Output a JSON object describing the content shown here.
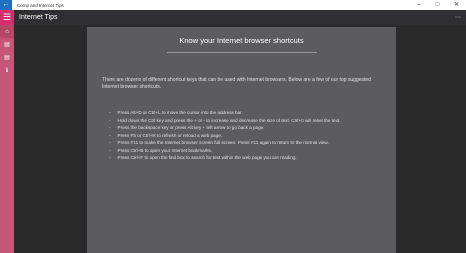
{
  "window": {
    "title": "Comp and Internet Tips",
    "back_icon": "←",
    "minimize_icon": "–",
    "maximize_icon": "□",
    "close_icon": "✕"
  },
  "appbar": {
    "title": "Internet Tips",
    "menu_icon": "☰",
    "more_icon": "⋯"
  },
  "sidebar": {
    "items": [
      {
        "icon": "⌂",
        "name": "home"
      },
      {
        "icon": "▤",
        "name": "list"
      },
      {
        "icon": "▤",
        "name": "list-alt"
      },
      {
        "icon": "ℹ",
        "name": "info"
      }
    ]
  },
  "content": {
    "heading": "Know your Internet browser shortcuts",
    "intro": "There are dozens of different shortcut keys that can be used with Internet browsers. Below are a few of our top suggested Internet browser shortcuts.",
    "tips": [
      "Press Alt+D or Ctrl+L to move the cursor into the address bar.",
      "Hold down the Ctrl key and press the + or - to increase and decrease the size of text. Ctrl+0 will reset the text.",
      "Press the backspace key or press Alt key + left arrow to go back a page.",
      "Press F5 or Ctrl+R to refresh or reload a web page.",
      "Press F11 to make the Internet browser screen full screen. Press F11 again to return to the normal view.",
      "Press Ctrl+B to open your Internet bookmarks.",
      "Press Ctrl+F to open the find box to search for text within the web page you are reading."
    ]
  }
}
